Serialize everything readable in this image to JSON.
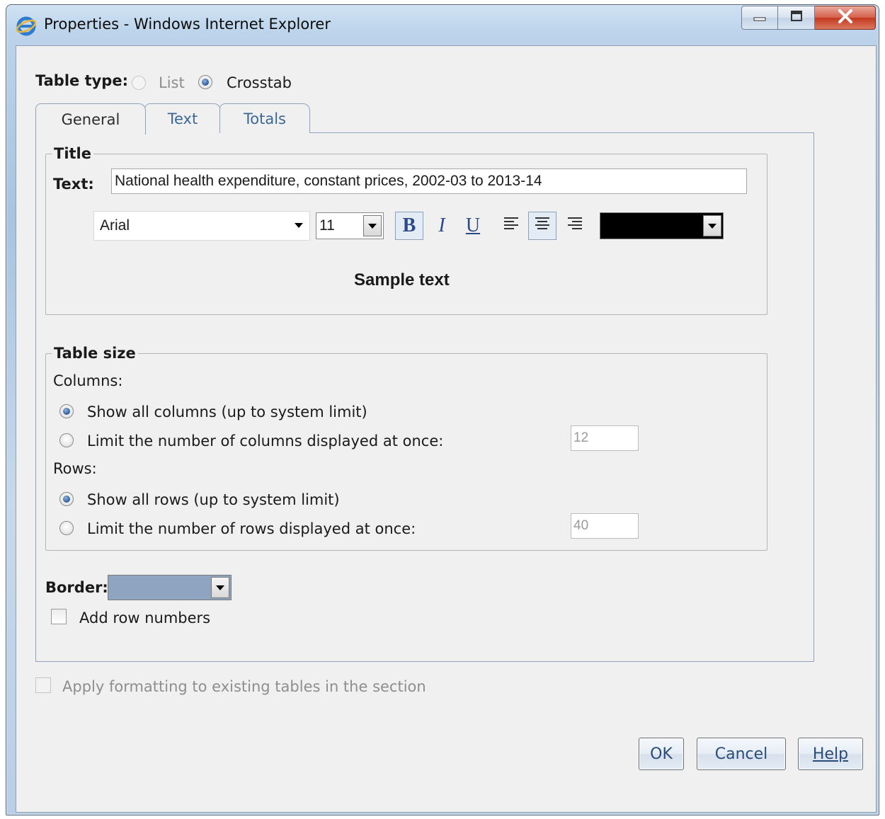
{
  "window": {
    "title": "Properties - Windows Internet Explorer",
    "icon": "internet-explorer-icon"
  },
  "table_type": {
    "label": "Table type:",
    "options": [
      {
        "label": "List",
        "selected": false,
        "enabled": false
      },
      {
        "label": "Crosstab",
        "selected": true,
        "enabled": true
      }
    ]
  },
  "tabs": [
    {
      "label": "General",
      "active": true
    },
    {
      "label": "Text",
      "active": false
    },
    {
      "label": "Totals",
      "active": false
    }
  ],
  "title_group": {
    "legend": "Title",
    "text_label": "Text:",
    "text_value": "National health expenditure, constant prices, 2002-03 to 2013-14",
    "font": "Arial",
    "font_size": "11",
    "bold_label": "B",
    "italic_label": "I",
    "underline_label": "U",
    "alignment": "center",
    "text_color": "#000000",
    "sample": "Sample text"
  },
  "table_size": {
    "legend": "Table size",
    "columns_label": "Columns:",
    "columns_options": [
      {
        "label": "Show all columns (up to system limit)",
        "selected": true
      },
      {
        "label": "Limit the number of columns displayed at once:",
        "selected": false
      }
    ],
    "columns_limit": "12",
    "rows_label": "Rows:",
    "rows_options": [
      {
        "label": "Show all rows (up to system limit)",
        "selected": true
      },
      {
        "label": "Limit the number of rows displayed at once:",
        "selected": false
      }
    ],
    "rows_limit": "40"
  },
  "border": {
    "label": "Border:",
    "color": "#8fa4c0"
  },
  "add_row_numbers": {
    "label": "Add row numbers",
    "checked": false
  },
  "apply_formatting": {
    "label": "Apply formatting to existing tables in the section",
    "checked": false,
    "enabled": false
  },
  "buttons": {
    "ok": "OK",
    "cancel": "Cancel",
    "help": "Help"
  }
}
